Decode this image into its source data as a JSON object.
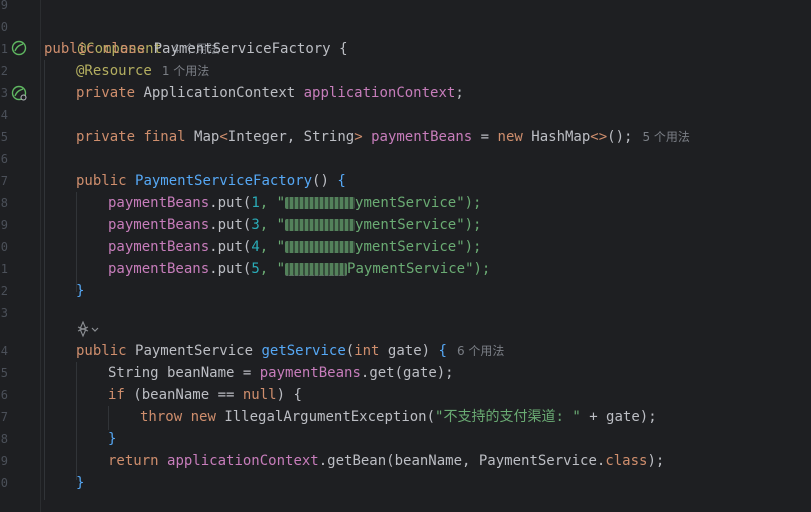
{
  "gutter": {
    "line_numbers": [
      "9",
      "0",
      "1",
      "2",
      "3",
      "4",
      "5",
      "6",
      "7",
      "8",
      "9",
      "0",
      "1",
      "2",
      "3",
      "",
      "4",
      "5",
      "6",
      "7",
      "8",
      "9",
      "0"
    ]
  },
  "code": {
    "annotation_component": "@Component",
    "hint_component": "4 个用法",
    "class_decl_kw1": "public",
    "class_decl_kw2": "class",
    "class_name": "PaymentServiceFactory",
    "brace_open": "{",
    "annotation_resource": "@Resource",
    "hint_resource": "1 个用法",
    "private_kw": "private",
    "app_ctx_type": "ApplicationContext",
    "app_ctx_field": "applicationContext",
    "semicolon": ";",
    "final_kw": "final",
    "map_type_open": "Map",
    "lt": "<",
    "map_generics": "Integer, String",
    "gt": ">",
    "payment_beans_field": "paymentBeans",
    "eq": " = ",
    "new_kw": "new",
    "hashmap": "HashMap",
    "diamond": "<>",
    "call_end": "();",
    "hint_beans": "5 个用法",
    "ctor_name": "PaymentServiceFactory",
    "paren_empty": "()",
    "puts": [
      {
        "num": "1",
        "visible_suffix": "ymentService",
        "suffix_after": "\");"
      },
      {
        "num": "3",
        "visible_suffix": "ymentService",
        "suffix_after": "\");"
      },
      {
        "num": "4",
        "visible_suffix": "ymentService",
        "suffix_after": "\");"
      },
      {
        "num": "5",
        "visible_suffix": "PaymentService",
        "suffix_after": "\");"
      }
    ],
    "put_call": ".put(",
    "comma_quote": ", \"",
    "brace_close": "}",
    "return_type": "PaymentService",
    "method_name": "getService",
    "paren_open": "(",
    "int_kw": "int",
    "param": " gate",
    "paren_close": ")",
    "hint_method": "6 个用法",
    "string_type": "String",
    "bean_name_var": " beanName = ",
    "get_call": ".get(gate);",
    "if_kw": "if",
    "if_cond_a": " (beanName == ",
    "null_kw": "null",
    "if_cond_b": ") {",
    "throw_kw": "throw",
    "exception": " IllegalArgumentException(",
    "error_msg": "\"不支持的支付渠道: \"",
    "concat_gate": " + gate);",
    "return_kw": "return",
    "get_bean_call": ".getBean(beanName, PaymentService.",
    "class_kw": "class",
    "close_semi": ");"
  },
  "colors": {
    "background": "#1e1f22",
    "keyword": "#cf8e6d",
    "annotation": "#b3ae60",
    "field": "#c77dbb",
    "function": "#56a8f5",
    "string": "#6aab73",
    "number": "#2aacb8"
  },
  "icons": {
    "gutter_bean": "spring-bean-icon",
    "ai_assist": "ai-assistant-icon"
  }
}
